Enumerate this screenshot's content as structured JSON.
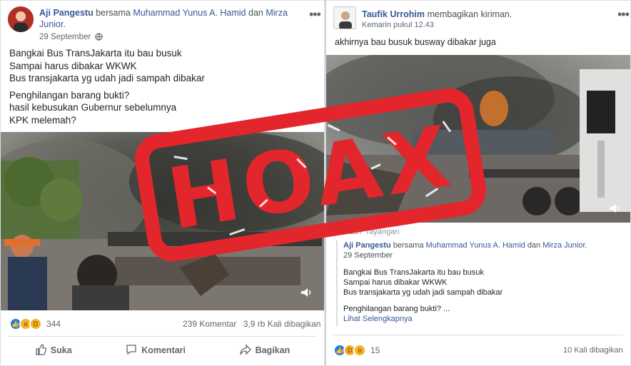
{
  "left_post": {
    "author": "Aji Pangestu",
    "with_word": "bersama",
    "tagged_1": "Muhammad Yunus A. Hamid",
    "and_word": "dan",
    "tagged_2": "Mirza Junior.",
    "date": "29 September",
    "text_lines": [
      "Bangkai Bus TransJakarta itu bau busuk",
      "Sampai harus dibakar WKWK",
      "Bus transjakarta yg udah jadi sampah dibakar",
      "Penghilangan barang bukti?",
      "hasil kebusukan Gubernur sebelumnya",
      "KPK melemah?"
    ],
    "reaction_count": "344",
    "comments": "239 Komentar",
    "shares": "3,9 rb Kali dibagikan",
    "actions": {
      "like": "Suka",
      "comment": "Komentari",
      "share": "Bagikan"
    }
  },
  "right_post": {
    "author": "Taufik Urrohim",
    "action_text": "membagikan kiriman.",
    "date": "Kemarin pukul 12.43",
    "text": "akhirnya bau busuk busway dibakar juga",
    "views": "105.237 Tayangan",
    "shared": {
      "author": "Aji Pangestu",
      "with_word": "bersama",
      "tagged_1": "Muhammad Yunus A. Hamid",
      "and_word": "dan",
      "tagged_2": "Mirza Junior.",
      "date": "29 September",
      "lines": [
        "Bangkai Bus TransJakarta itu bau busuk",
        "Sampai harus dibakar WKWK",
        "Bus transjakarta yg udah jadi sampah dibakar",
        "Penghilangan barang bukti? ..."
      ],
      "see_more": "Lihat Selengkapnya"
    },
    "reaction_count": "15",
    "shares": "10 Kali dibagikan"
  },
  "stamp_text": "HOAX",
  "colors": {
    "link": "#385898",
    "stamp": "#e2262c",
    "like_blue": "#1877f2",
    "emoji_yellow": "#f7b125"
  }
}
